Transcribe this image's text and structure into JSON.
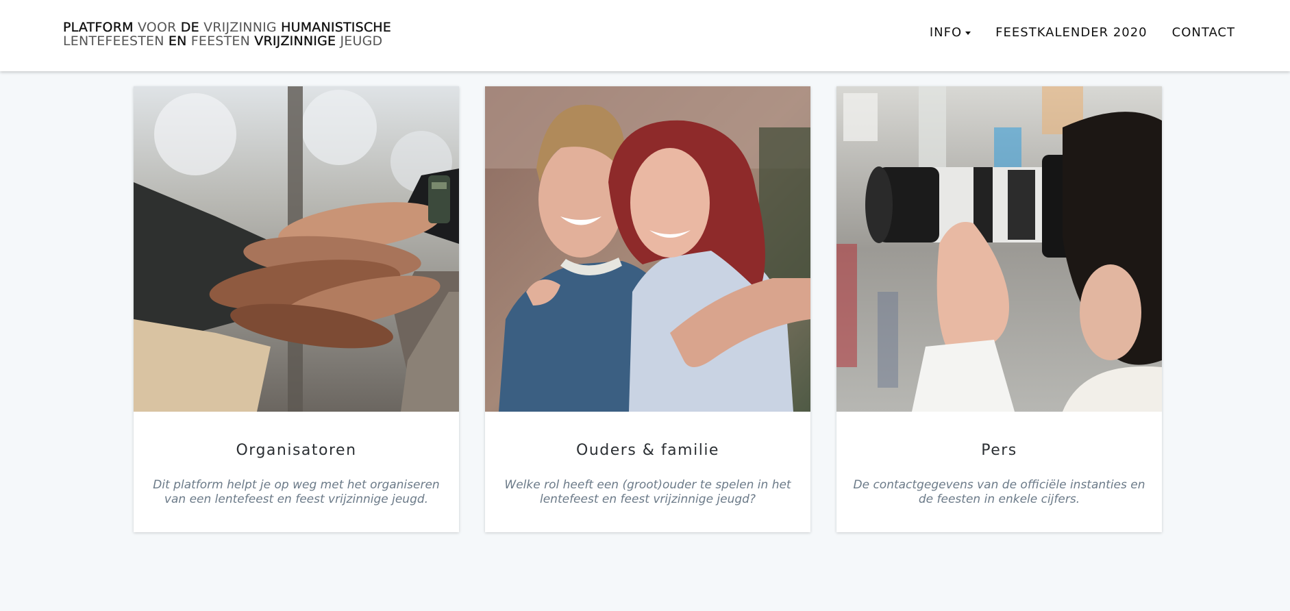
{
  "header": {
    "logo": {
      "line1": [
        {
          "text": "PLATFORM",
          "bold": true
        },
        {
          "text": "VOOR",
          "bold": false
        },
        {
          "text": "DE",
          "bold": true
        },
        {
          "text": "VRIJZINNIG",
          "bold": false
        },
        {
          "text": "HUMANISTISCHE",
          "bold": true
        }
      ],
      "line2": [
        {
          "text": "LENTEFEESTEN",
          "bold": false
        },
        {
          "text": "EN",
          "bold": true
        },
        {
          "text": "FEESTEN",
          "bold": false
        },
        {
          "text": "VRIJZINNIGE",
          "bold": true
        },
        {
          "text": "JEUGD",
          "bold": false
        }
      ]
    },
    "nav": {
      "info": "INFO",
      "calendar": "FEESTKALENDER 2020",
      "contact": "CONTACT"
    }
  },
  "cards": [
    {
      "title": "Organisatoren",
      "description": "Dit platform helpt je op weg met het organiseren van een lentefeest en feest vrijzinnige jeugd.",
      "image": "stacked-hands-photo"
    },
    {
      "title": "Ouders & familie",
      "description": "Welke rol heeft een (groot)ouder te spelen in het lentefeest en feest vrijzinnige jeugd?",
      "image": "smiling-couple-photo"
    },
    {
      "title": "Pers",
      "description": "De contactgegevens van de officiële instanties en de feesten in enkele cijfers.",
      "image": "photographer-camera-photo"
    }
  ],
  "colors": {
    "page_background": "#f5f8fa",
    "card_background": "#ffffff",
    "title_text": "#2b2f33",
    "description_text": "#6b7a88"
  }
}
